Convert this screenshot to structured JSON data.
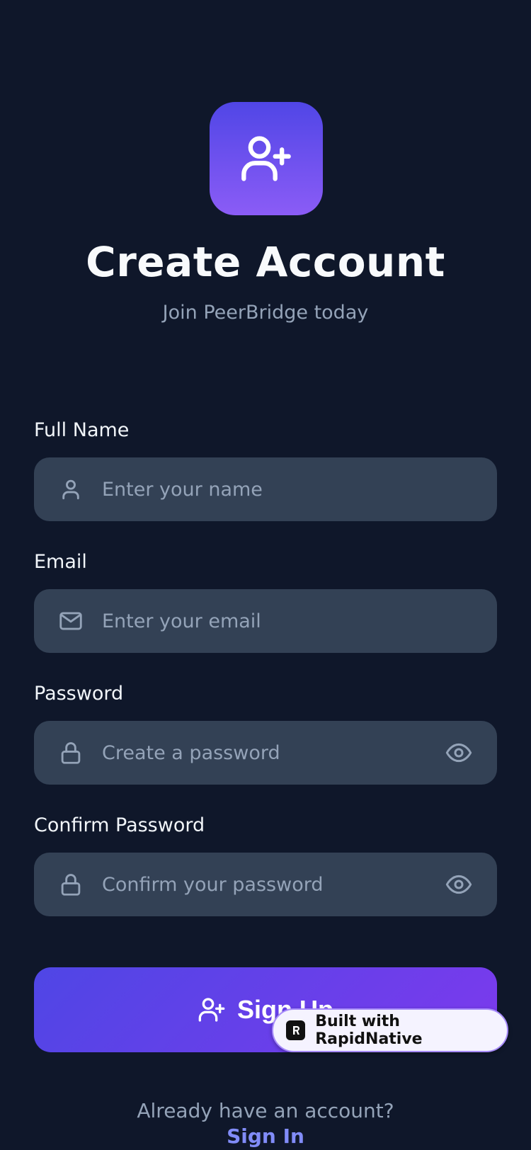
{
  "header": {
    "title": "Create Account",
    "subtitle": "Join PeerBridge today",
    "logo_icon": "user-plus-icon"
  },
  "form": {
    "full_name": {
      "label": "Full Name",
      "placeholder": "Enter your name",
      "value": "",
      "icon": "user-icon"
    },
    "email": {
      "label": "Email",
      "placeholder": "Enter your email",
      "value": "",
      "icon": "mail-icon"
    },
    "password": {
      "label": "Password",
      "placeholder": "Create a password",
      "value": "",
      "icon": "lock-icon",
      "toggle_icon": "eye-icon"
    },
    "confirm_password": {
      "label": "Confirm Password",
      "placeholder": "Confirm your password",
      "value": "",
      "icon": "lock-icon",
      "toggle_icon": "eye-icon"
    }
  },
  "actions": {
    "signup_label": "Sign Up",
    "signup_icon": "user-plus-icon"
  },
  "badge": {
    "text": "Built with RapidNative"
  },
  "footer": {
    "prompt": "Already have an account?",
    "signin_label": "Sign In"
  },
  "colors": {
    "background": "#0f172a",
    "field_background": "#334155",
    "accent_start": "#4f46e5",
    "accent_end": "#7c3aed",
    "link": "#818cf8",
    "muted_text": "#94a3b8"
  }
}
